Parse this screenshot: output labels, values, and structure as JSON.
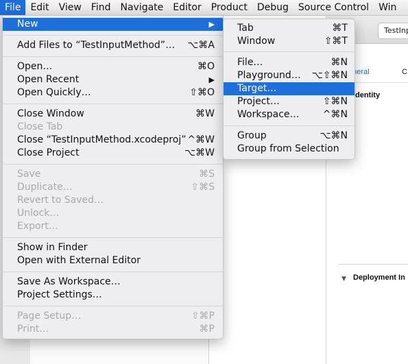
{
  "menubar": {
    "items": [
      "File",
      "Edit",
      "View",
      "Find",
      "Navigate",
      "Editor",
      "Product",
      "Debug",
      "Source Control",
      "Win"
    ]
  },
  "window": {
    "scheme_field": "TestInp",
    "tab_general": "eneral",
    "tab_c": "C",
    "identity_label": "dentity",
    "deployment_label": "Deployment In"
  },
  "file_menu": {
    "new": {
      "label": "New",
      "arrow": "▶"
    },
    "add_files": {
      "label": "Add Files to “TestInputMethod”…",
      "shortcut": "⌥⌘A"
    },
    "open": {
      "label": "Open…",
      "shortcut": "⌘O"
    },
    "open_recent": {
      "label": "Open Recent",
      "arrow": "▶"
    },
    "open_quickly": {
      "label": "Open Quickly…",
      "shortcut": "⇧⌘O"
    },
    "close_window": {
      "label": "Close Window",
      "shortcut": "⌘W"
    },
    "close_tab": {
      "label": "Close Tab"
    },
    "close_project_file": {
      "label": "Close “TestInputMethod.xcodeproj”",
      "shortcut": "^⌘W"
    },
    "close_project": {
      "label": "Close Project",
      "shortcut": "⌥⌘W"
    },
    "save": {
      "label": "Save",
      "shortcut": "⌘S"
    },
    "duplicate": {
      "label": "Duplicate…",
      "shortcut": "⇧⌘S"
    },
    "revert": {
      "label": "Revert to Saved…"
    },
    "unlock": {
      "label": "Unlock…"
    },
    "export": {
      "label": "Export…"
    },
    "show_in_finder": {
      "label": "Show in Finder"
    },
    "open_external": {
      "label": "Open with External Editor"
    },
    "save_workspace": {
      "label": "Save As Workspace…"
    },
    "project_settings": {
      "label": "Project Settings…"
    },
    "page_setup": {
      "label": "Page Setup…",
      "shortcut": "⇧⌘P"
    },
    "print": {
      "label": "Print…",
      "shortcut": "⌘P"
    }
  },
  "new_submenu": {
    "tab": {
      "label": "Tab",
      "shortcut": "⌘T"
    },
    "window": {
      "label": "Window",
      "shortcut": "⇧⌘T"
    },
    "file": {
      "label": "File…",
      "shortcut": "⌘N"
    },
    "playground": {
      "label": "Playground…",
      "shortcut": "⌥⇧⌘N"
    },
    "target": {
      "label": "Target…"
    },
    "project": {
      "label": "Project…",
      "shortcut": "⇧⌘N"
    },
    "workspace": {
      "label": "Workspace…",
      "shortcut": "^⌘N"
    },
    "group": {
      "label": "Group",
      "shortcut": "⌥⌘N"
    },
    "group_from_selection": {
      "label": "Group from Selection"
    }
  },
  "colors": {
    "accent": "#1e6fd9",
    "disabled_text": "#a8a8a8"
  }
}
